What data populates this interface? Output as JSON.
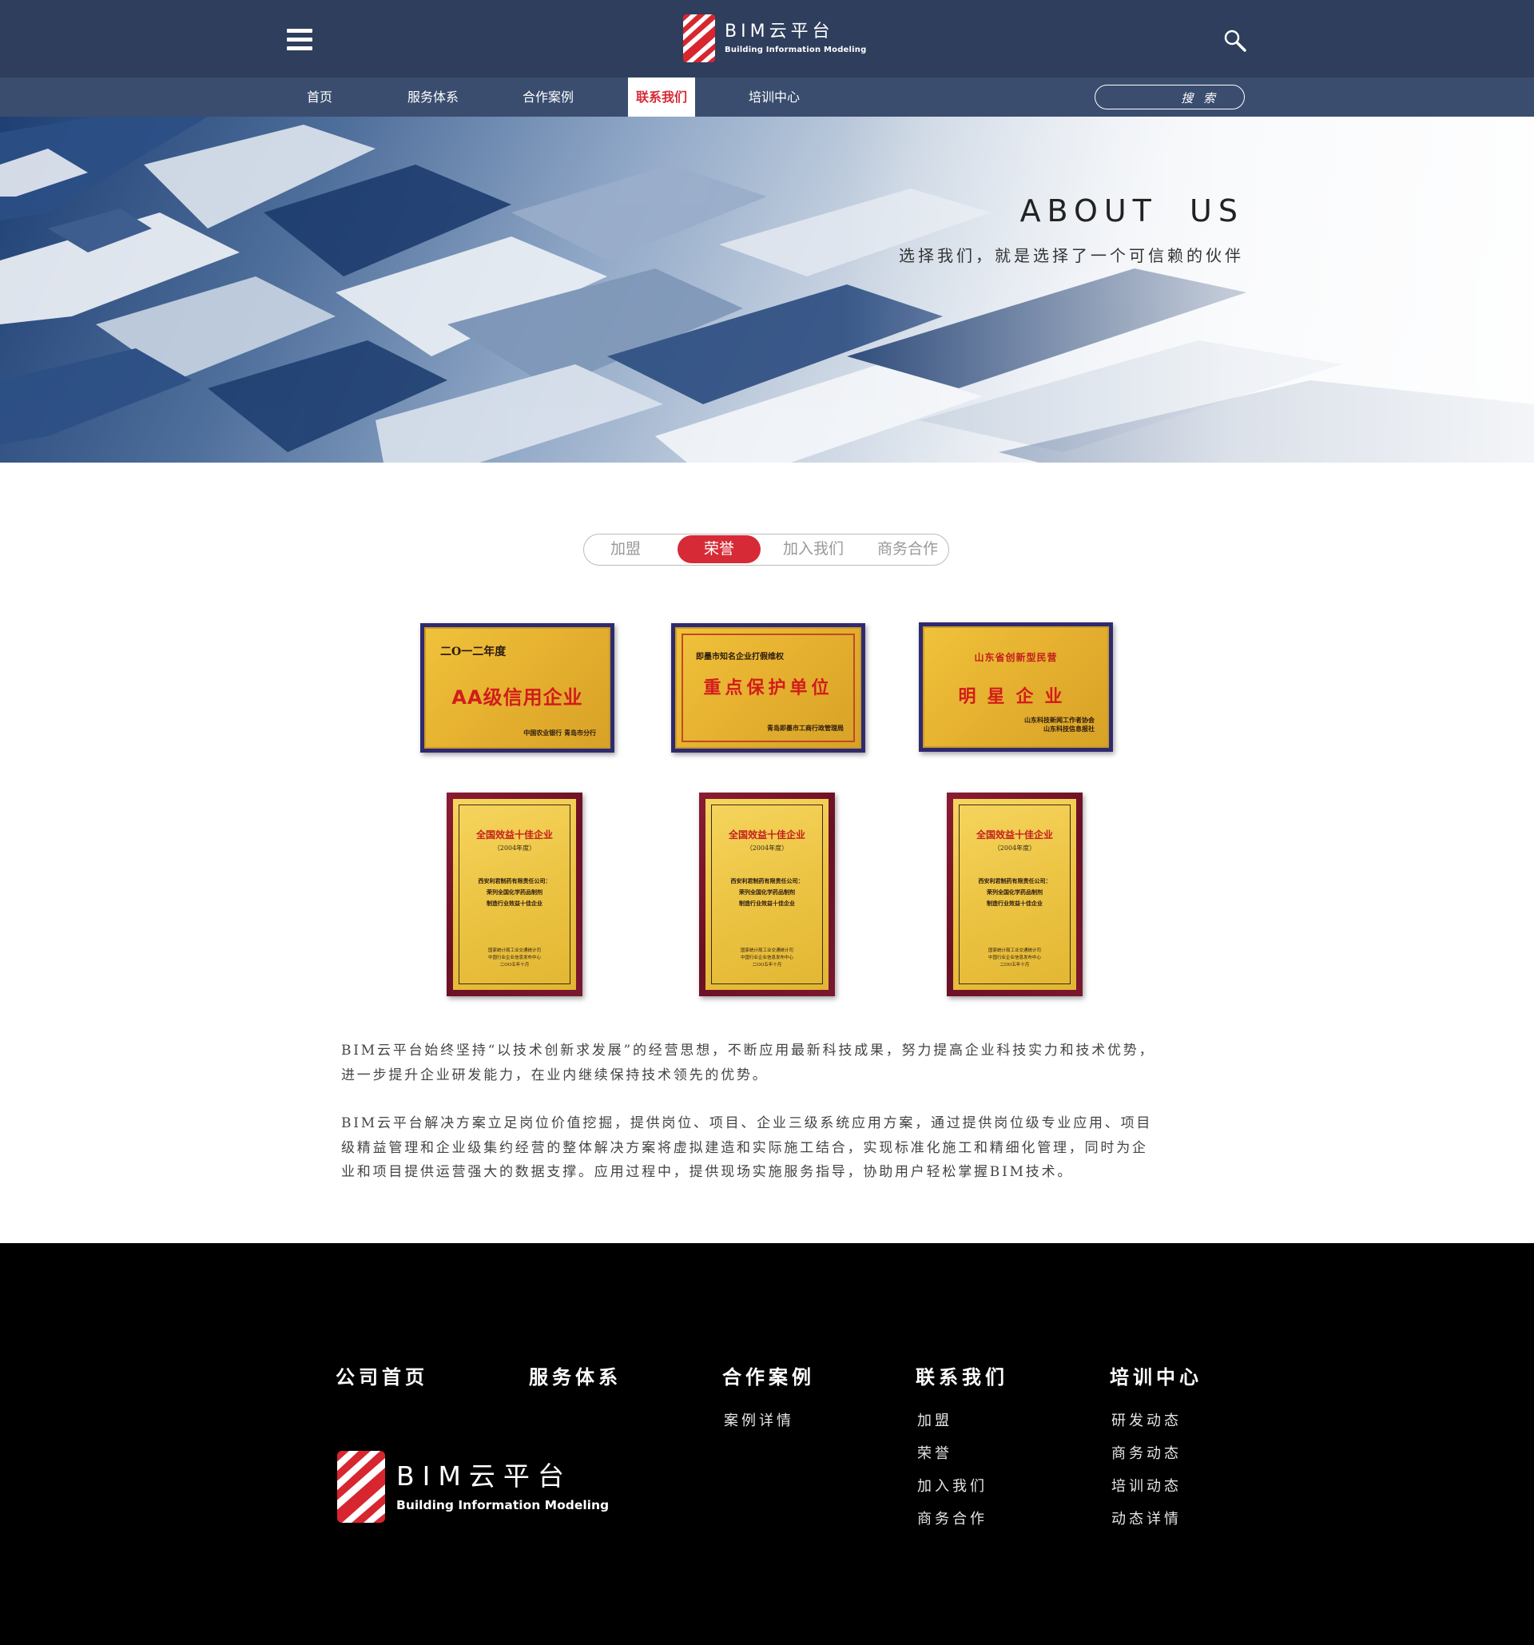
{
  "header": {
    "logo_title": "BIM云平台",
    "logo_subtitle": "Building Information Modeling"
  },
  "nav": {
    "items": [
      {
        "label": "首页",
        "active": false
      },
      {
        "label": "服务体系",
        "active": false
      },
      {
        "label": "合作案例",
        "active": false
      },
      {
        "label": "联系我们",
        "active": true
      },
      {
        "label": "培训中心",
        "active": false
      }
    ],
    "search_placeholder": "搜 索"
  },
  "banner": {
    "title": "ABOUT  US",
    "subtitle": "选择我们，就是选择了一个可信赖的伙伴"
  },
  "tabs": [
    {
      "label": "加盟",
      "active": false
    },
    {
      "label": "荣誉",
      "active": true
    },
    {
      "label": "加入我们",
      "active": false
    },
    {
      "label": "商务合作",
      "active": false
    }
  ],
  "honors": {
    "plaque1": {
      "year": "二O一二年度",
      "main": "AA级信用企业",
      "foot": "中国农业银行 青岛市分行"
    },
    "plaque2": {
      "top": "即墨市知名企业打假维权",
      "main": "重点保护单位",
      "foot": "青岛即墨市工商行政管理局"
    },
    "plaque3": {
      "top": "山东省创新型民营",
      "main": "明星企业",
      "foot1": "山东科技新闻工作者协会",
      "foot2": "山东科技信息报社"
    },
    "certificate": {
      "title": "全国效益十佳企业",
      "year": "（2004年度）",
      "company": "西安利君制药有限责任公司：",
      "body1": "荣列全国化学药品制剂",
      "body2": "制造行业效益十佳企业",
      "issuer1": "国家统计局工业交通统计司",
      "issuer2": "中国行业企业信息发布中心",
      "date": "二OO五年十月"
    }
  },
  "paragraphs": {
    "p1_line1": "BIM云平台始终坚持“以技术创新求发展”的经营思想，不断应用最新科技成果，努力提高企业科技实力和技术优势，",
    "p1_line2": "进一步提升企业研发能力，在业内继续保持技术领先的优势。",
    "p2_line1": "BIM云平台解决方案立足岗位价值挖掘，提供岗位、项目、企业三级系统应用方案，通过提供岗位级专业应用、项目",
    "p2_line2": "级精益管理和企业级集约经营的整体解决方案将虚拟建造和实际施工结合，实现标准化施工和精细化管理，同时为企",
    "p2_line3": "业和项目提供运营强大的数据支撑。应用过程中，提供现场实施服务指导，协助用户轻松掌握BIM技术。"
  },
  "footer": {
    "columns": [
      {
        "title": "公司首页",
        "links": []
      },
      {
        "title": "服务体系",
        "links": []
      },
      {
        "title": "合作案例",
        "links": [
          "案例详情"
        ]
      },
      {
        "title": "联系我们",
        "links": [
          "加盟",
          "荣誉",
          "加入我们",
          "商务合作"
        ]
      },
      {
        "title": "培训中心",
        "links": [
          "研发动态",
          "商务动态",
          "培训动态",
          "动态详情"
        ]
      }
    ],
    "logo_title": "BIM云平台",
    "logo_subtitle": "Building Information Modeling"
  },
  "colors": {
    "header_bg": "#2e3e5c",
    "nav_bg": "#3a4d6e",
    "accent_red": "#d62b37",
    "footer_bg": "#000000"
  },
  "icons": [
    "menu-icon",
    "search-icon",
    "logo-mark"
  ]
}
